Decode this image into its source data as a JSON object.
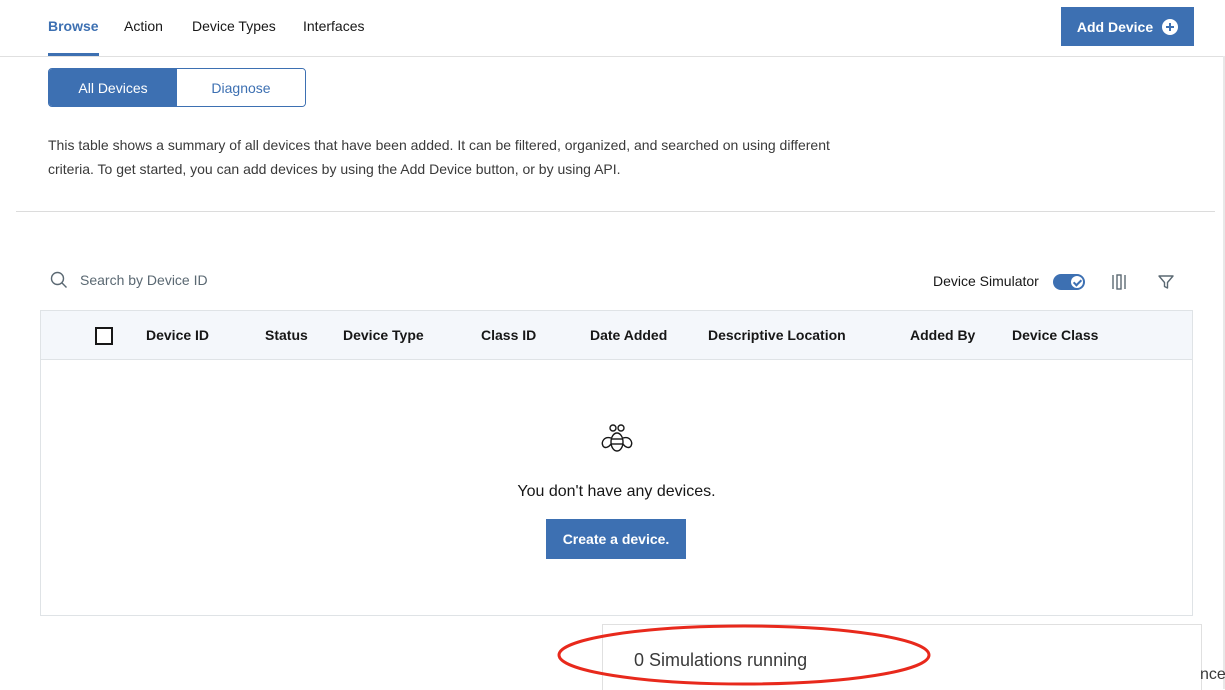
{
  "nav": {
    "tabs": [
      {
        "label": "Browse",
        "active": true
      },
      {
        "label": "Action",
        "active": false
      },
      {
        "label": "Device Types",
        "active": false
      },
      {
        "label": "Interfaces",
        "active": false
      }
    ],
    "add_device_label": "Add Device",
    "add_device_icon": "plus-circle-icon"
  },
  "segmented": {
    "options": [
      "All Devices",
      "Diagnose"
    ],
    "selected": "All Devices"
  },
  "description": "This table shows a summary of all devices that have been added. It can be filtered, organized, and searched on using different criteria. To get started, you can add devices by using the Add Device button, or by using API.",
  "toolbar": {
    "search_placeholder": "Search by Device ID",
    "simulator_label": "Device Simulator",
    "simulator_on": true
  },
  "table": {
    "columns": [
      "Device ID",
      "Status",
      "Device Type",
      "Class ID",
      "Date Added",
      "Descriptive Location",
      "Added By",
      "Device Class"
    ],
    "rows": [],
    "empty_icon": "bee-icon",
    "empty_message": "You don't have any devices.",
    "create_label": "Create a device."
  },
  "simulations": {
    "status_text": "0 Simulations running",
    "partial_text": "nce"
  },
  "colors": {
    "accent": "#3d70b2",
    "annotation": "#e8291c"
  }
}
